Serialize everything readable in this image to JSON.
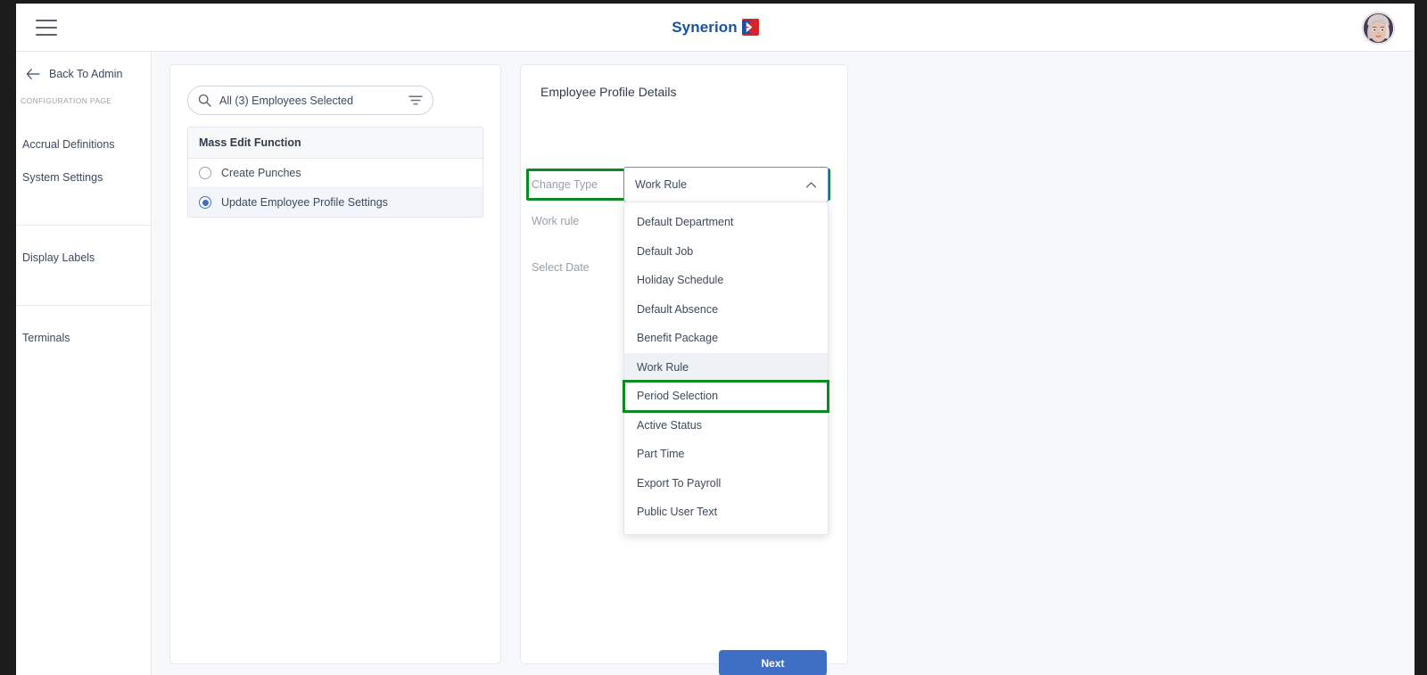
{
  "header": {
    "menu_icon": "hamburger-menu-icon",
    "brand_text": "Synerion",
    "brand_mark": "synerion-logo-mark",
    "avatar_alt": "user-avatar"
  },
  "sidebar": {
    "back_label": "Back To Admin",
    "back_icon": "arrow-left-icon",
    "section_caption": "CONFIGURATION PAGE",
    "group_one": [
      {
        "label": "Accrual Definitions"
      },
      {
        "label": "System Settings"
      }
    ],
    "group_two": [
      {
        "label": "Display Labels"
      }
    ],
    "group_three": [
      {
        "label": "Terminals"
      }
    ]
  },
  "left_panel": {
    "search": {
      "icon": "search-icon",
      "value": "All (3) Employees Selected",
      "placeholder": "Search employees",
      "filter_icon": "filter-icon"
    },
    "list": {
      "header": "Mass Edit Function",
      "rows": [
        {
          "label": "Create Punches",
          "selected": false
        },
        {
          "label": "Update Employee Profile Settings",
          "selected": true
        }
      ]
    }
  },
  "right_panel": {
    "title": "Employee Profile Details",
    "change_type_label": "Change Type",
    "selected_value": "Work Rule",
    "caret_icon": "chevron-up-icon",
    "work_rule_label": "Work rule",
    "select_date_label": "Select Date",
    "next_label": "Next",
    "dropdown_options": [
      {
        "label": "Default Department",
        "active": false,
        "marked": false
      },
      {
        "label": "Default Job",
        "active": false,
        "marked": false
      },
      {
        "label": "Holiday Schedule",
        "active": false,
        "marked": false
      },
      {
        "label": "Default Absence",
        "active": false,
        "marked": false
      },
      {
        "label": "Benefit Package",
        "active": false,
        "marked": false
      },
      {
        "label": "Work Rule",
        "active": true,
        "marked": false
      },
      {
        "label": "Period Selection",
        "active": false,
        "marked": true
      },
      {
        "label": "Active Status",
        "active": false,
        "marked": false
      },
      {
        "label": "Part Time",
        "active": false,
        "marked": false
      },
      {
        "label": "Export To Payroll",
        "active": false,
        "marked": false
      },
      {
        "label": "Public User Text",
        "active": false,
        "marked": false
      }
    ]
  },
  "colors": {
    "brand_blue": "#1454a3",
    "accent_blue": "#3f6fc4",
    "highlight_green": "#0a8a21",
    "page_bg": "#f6f8fb",
    "text": "#3c4a5c",
    "muted_text": "#97a0ab"
  }
}
